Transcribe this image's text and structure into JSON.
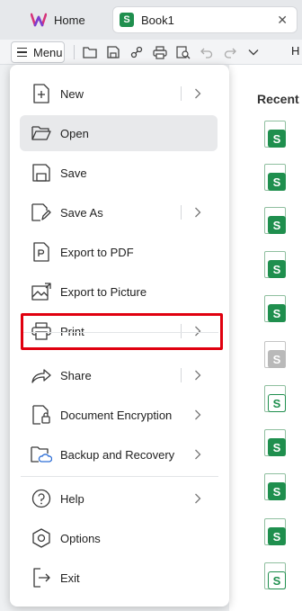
{
  "tabs": {
    "home_label": "Home",
    "book_label": "Book1",
    "book_badge": "S",
    "close_glyph": "✕"
  },
  "toolbar": {
    "menu_label": "Menu",
    "overflow_text": "H",
    "icons": [
      "folder-icon",
      "save-icon",
      "share-link-icon",
      "print-icon",
      "print-preview-icon",
      "undo-icon",
      "redo-icon",
      "chevron-down-icon"
    ]
  },
  "menu": {
    "items": [
      {
        "label": "New",
        "icon": "new-file-icon",
        "has_submenu": true
      },
      {
        "label": "Open",
        "icon": "folder-open-icon",
        "has_submenu": false,
        "active": true
      },
      {
        "label": "Save",
        "icon": "save-icon",
        "has_submenu": false
      },
      {
        "label": "Save As",
        "icon": "save-as-icon",
        "has_submenu": true
      },
      {
        "label": "Export to PDF",
        "icon": "export-pdf-icon",
        "has_submenu": false
      },
      {
        "label": "Export to Picture",
        "icon": "export-picture-icon",
        "has_submenu": false
      },
      {
        "label": "Print",
        "icon": "print-icon",
        "has_submenu": true,
        "highlighted": true
      },
      {
        "label": "Share",
        "icon": "share-icon",
        "has_submenu": true
      },
      {
        "label": "Document Encryption",
        "icon": "encryption-icon",
        "has_submenu": true
      },
      {
        "label": "Backup and Recovery",
        "icon": "backup-icon",
        "has_submenu": true
      },
      {
        "label": "Help",
        "icon": "help-icon",
        "has_submenu": true
      },
      {
        "label": "Options",
        "icon": "options-icon",
        "has_submenu": false
      },
      {
        "label": "Exit",
        "icon": "exit-icon",
        "has_submenu": false
      }
    ]
  },
  "recent": {
    "title": "Recent",
    "file_badge": "S",
    "files": [
      "green",
      "green",
      "green",
      "green",
      "green",
      "gray",
      "outline",
      "green",
      "green",
      "green",
      "outline"
    ]
  },
  "colors": {
    "accent_green": "#1f8f4e",
    "highlight_red": "#e0000f",
    "active_item_bg": "#e8e9eb"
  }
}
